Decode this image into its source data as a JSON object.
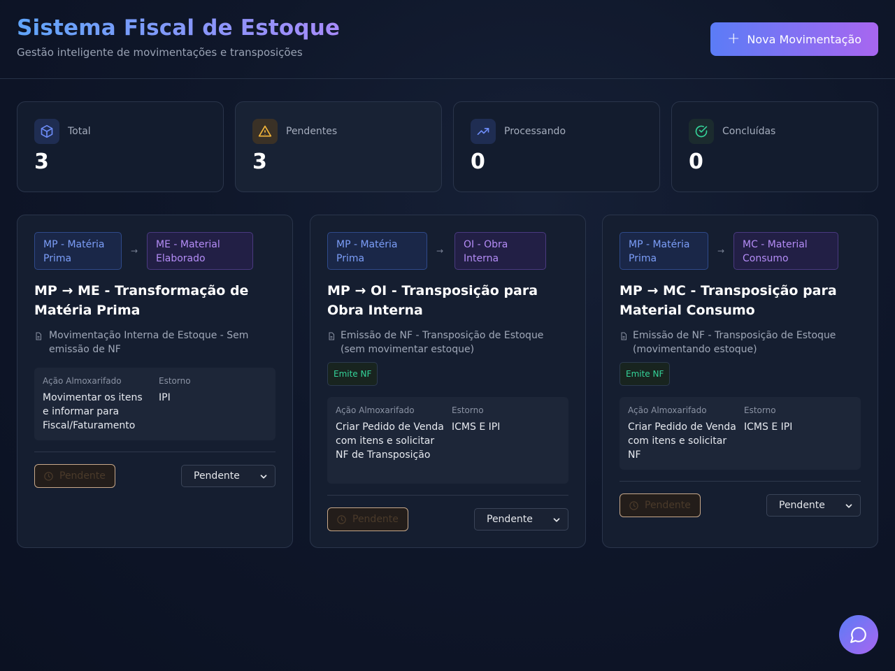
{
  "header": {
    "title": "Sistema Fiscal de Estoque",
    "subtitle": "Gestão inteligente de movimentações e transposições",
    "new_button_label": "Nova Movimentação"
  },
  "stats": [
    {
      "label": "Total",
      "value": "3",
      "icon": "box-icon",
      "color": "#6d8cf7"
    },
    {
      "label": "Pendentes",
      "value": "3",
      "icon": "warning-icon",
      "color": "#f5b73b"
    },
    {
      "label": "Processando",
      "value": "0",
      "icon": "trending-up-icon",
      "color": "#6d8cf7"
    },
    {
      "label": "Concluídas",
      "value": "0",
      "icon": "check-circle-icon",
      "color": "#34d399"
    }
  ],
  "movements": [
    {
      "from_tag": "MP - Matéria Prima",
      "to_tag": "ME - Material Elaborado",
      "title": "MP → ME - Transformação de Matéria Prima",
      "description": "Movimentação Interna de Estoque - Sem emissão de NF",
      "emits_nf": false,
      "nf_label": "",
      "action_label": "Ação Almoxarifado",
      "action_value": "Movimentar os itens e informar para Fiscal/Faturamento",
      "refund_label": "Estorno",
      "refund_value": "IPI",
      "status": "Pendente",
      "select_value": "Pendente"
    },
    {
      "from_tag": "MP - Matéria Prima",
      "to_tag": "OI - Obra Interna",
      "title": "MP → OI - Transposição para Obra Interna",
      "description": "Emissão de NF - Transposição de Estoque (sem movimentar estoque)",
      "emits_nf": true,
      "nf_label": "Emite NF",
      "action_label": "Ação Almoxarifado",
      "action_value": "Criar Pedido de Venda com itens e solicitar NF de Transposição",
      "refund_label": "Estorno",
      "refund_value": "ICMS E IPI",
      "status": "Pendente",
      "select_value": "Pendente"
    },
    {
      "from_tag": "MP - Matéria Prima",
      "to_tag": "MC - Material Consumo",
      "title": "MP → MC - Transposição para Material Consumo",
      "description": "Emissão de NF - Transposição de Estoque (movimentando estoque)",
      "emits_nf": true,
      "nf_label": "Emite NF",
      "action_label": "Ação Almoxarifado",
      "action_value": "Criar Pedido de Venda com itens e solicitar NF",
      "refund_label": "Estorno",
      "refund_value": "ICMS E IPI",
      "status": "Pendente",
      "select_value": "Pendente"
    }
  ],
  "colors": {
    "accent_start": "#5b7cf6",
    "accent_end": "#a866f0",
    "background": "#0f172a",
    "success": "#34d399",
    "warning": "#f5b73b"
  }
}
